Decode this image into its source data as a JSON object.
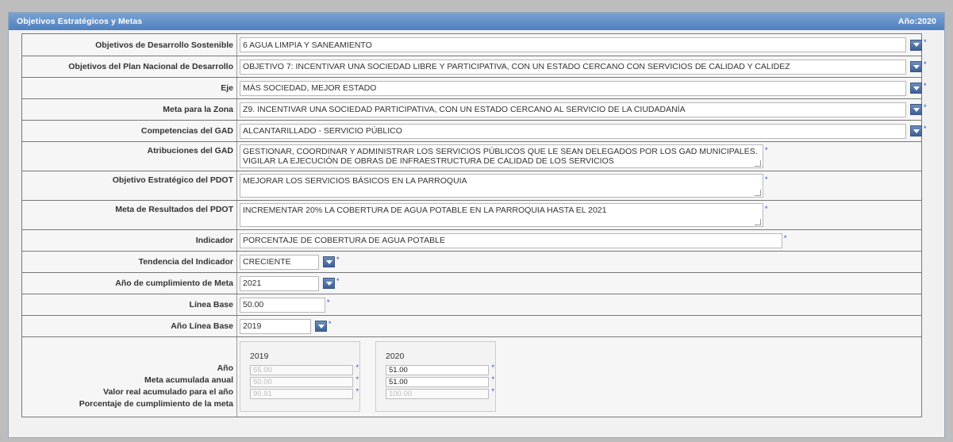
{
  "header": {
    "title": "Objetivos Estratégicos y Metas",
    "year_label": "Año:2020"
  },
  "fields": {
    "ods": {
      "label": "Objetivos de Desarrollo Sostenible",
      "value": "6 AGUA LIMPIA Y SANEAMIENTO"
    },
    "pnd": {
      "label": "Objetivos del Plan Nacional de Desarrollo",
      "value": "OBJETIVO 7: INCENTIVAR UNA SOCIEDAD LIBRE Y PARTICIPATIVA, CON UN ESTADO CERCANO CON SERVICIOS DE CALIDAD Y CALIDEZ"
    },
    "eje": {
      "label": "Eje",
      "value": "MÁS SOCIEDAD, MEJOR ESTADO"
    },
    "meta_zona": {
      "label": "Meta para la Zona",
      "value": "Z9. INCENTIVAR UNA SOCIEDAD PARTICIPATIVA, CON UN ESTADO CERCANO AL SERVICIO DE LA CIUDADANÍA"
    },
    "competencias": {
      "label": "Competencias del GAD",
      "value": "ALCANTARILLADO - SERVICIO PÚBLICO"
    },
    "atribuciones": {
      "label": "Atribuciones del GAD",
      "value": "GESTIONAR, COORDINAR Y ADMINISTRAR LOS SERVICIOS PÚBLICOS QUE LE SEAN DELEGADOS POR LOS GAD MUNICIPALES. VIGILAR LA EJECUCIÓN DE OBRAS DE INFRAESTRUCTURA DE CALIDAD DE LOS SERVICIOS"
    },
    "objetivo_pdot": {
      "label": "Objetivo Estratégico del PDOT",
      "value": "MEJORAR LOS SERVICIOS BÁSICOS EN LA PARROQUIA"
    },
    "meta_pdot": {
      "label": "Meta de Resultados del PDOT",
      "value": "INCREMENTAR 20% LA COBERTURA DE AGUA POTABLE EN LA PARROQUIA HASTA EL 2021"
    },
    "indicador": {
      "label": "Indicador",
      "value": "PORCENTAJE DE COBERTURA DE AGUA POTABLE"
    },
    "tendencia": {
      "label": "Tendencia del Indicador",
      "value": "CRECIENTE"
    },
    "anio_meta": {
      "label": "Año de cumplimiento de Meta",
      "value": "2021"
    },
    "linea_base": {
      "label": "Línea Base",
      "value": "50.00"
    },
    "anio_linea_base": {
      "label": "Año Línea Base",
      "value": "2019"
    }
  },
  "table": {
    "row_labels": [
      "Año",
      "Meta acumulada anual",
      "Valor real acumulado para el año",
      "Porcentaje de cumplimiento de la meta"
    ],
    "years": [
      {
        "year": "2019",
        "meta": "55.00",
        "valor": "50.00",
        "porcentaje": "90.91"
      },
      {
        "year": "2020",
        "meta": "51.00",
        "valor": "51.00",
        "porcentaje": "100.00"
      }
    ]
  },
  "required_mark": "*",
  "colors": {
    "header_bg": "#5a86c4",
    "accent_button": "#4a6ca3",
    "required": "#2244cc"
  }
}
